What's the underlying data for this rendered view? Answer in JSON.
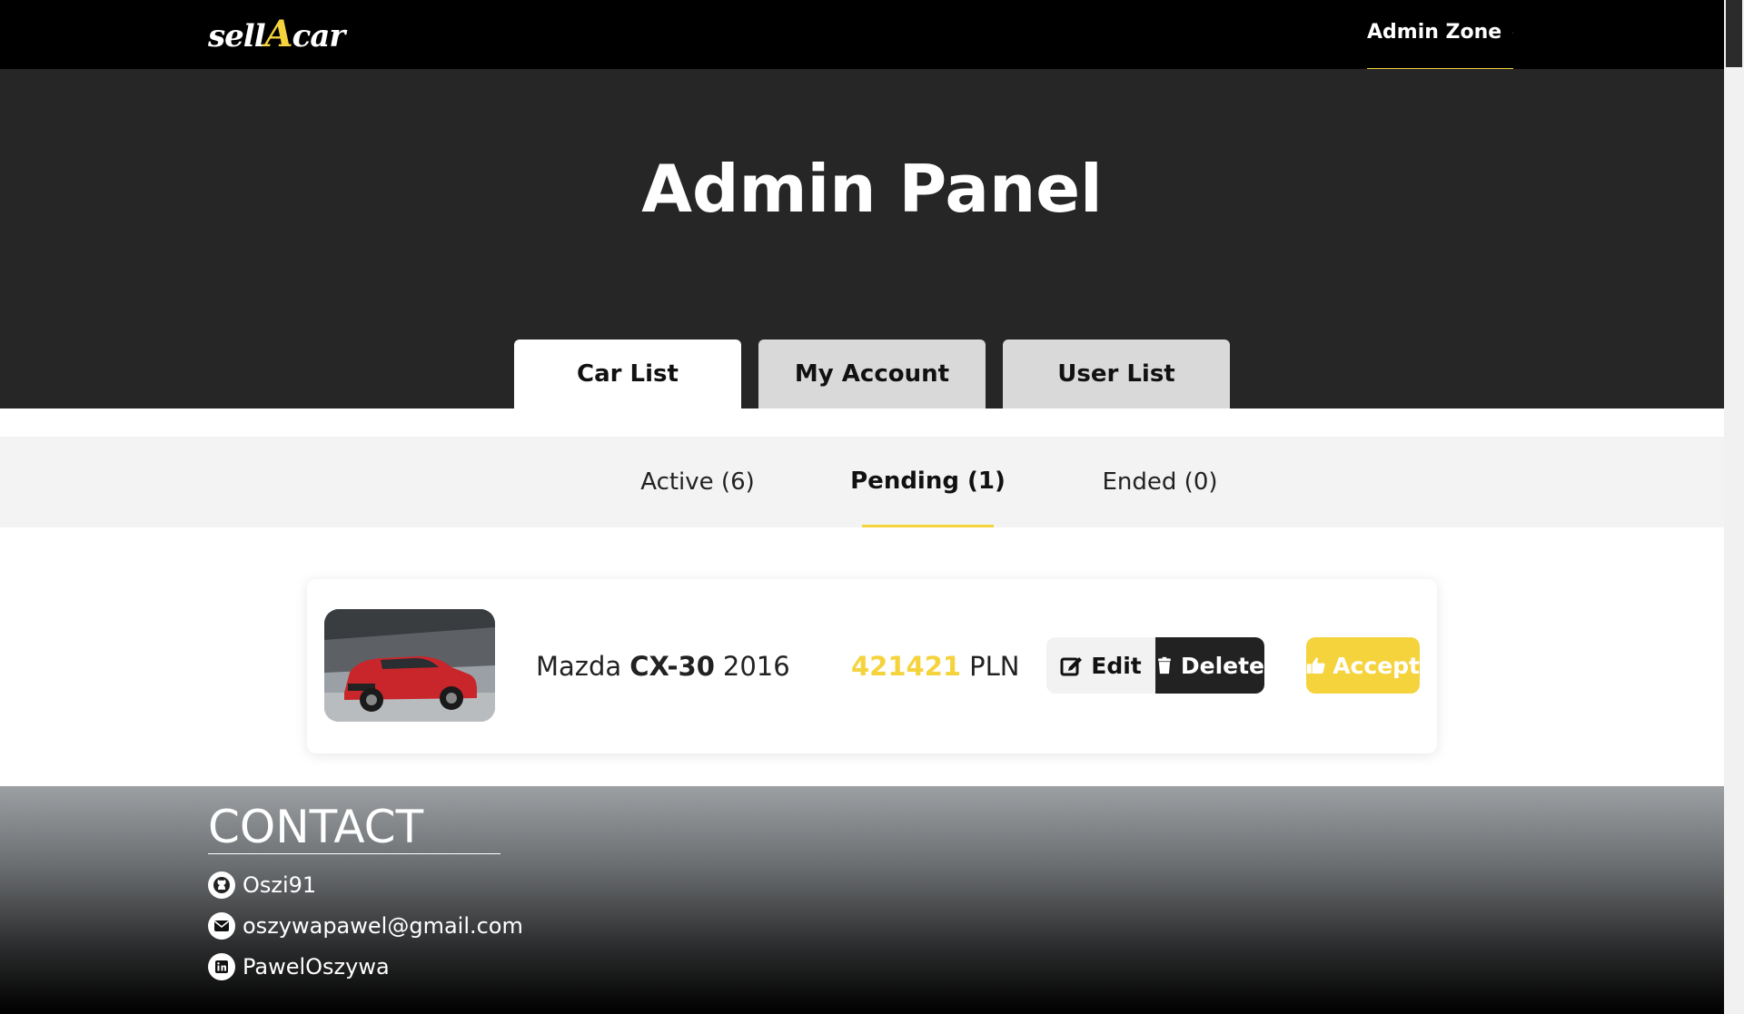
{
  "navbar": {
    "logo_prefix": "sell",
    "logo_accent": "A",
    "logo_suffix": "car",
    "admin_zone_label": "Admin Zone"
  },
  "hero": {
    "title": "Admin Panel"
  },
  "main_tabs": [
    {
      "label": "Car List",
      "active": true
    },
    {
      "label": "My Account",
      "active": false
    },
    {
      "label": "User List",
      "active": false
    }
  ],
  "sub_tabs": [
    {
      "label": "Active (6)",
      "active": false
    },
    {
      "label": "Pending (1)",
      "active": true
    },
    {
      "label": "Ended (0)",
      "active": false
    }
  ],
  "cars": [
    {
      "make": "Mazda",
      "model": "CX-30",
      "year": "2016",
      "price": "421421",
      "currency": "PLN",
      "edit_label": "Edit",
      "delete_label": "Delete",
      "accept_label": "Accept"
    }
  ],
  "footer": {
    "title": "CONTACT",
    "github": "Oszi91",
    "email": "oszywapawel@gmail.com",
    "linkedin": "PawelOszywa"
  },
  "colors": {
    "accent": "#f5d33d",
    "navbar_bg": "#000000",
    "hero_bg": "#262626",
    "tab_inactive": "#d9d9d9",
    "delete_bg": "#222222"
  },
  "icons": {
    "admin_zone": "user-icon",
    "edit": "edit-icon",
    "delete": "trash-icon",
    "accept": "thumbs-up-icon",
    "github": "github-icon",
    "email": "envelope-icon",
    "linkedin": "linkedin-icon"
  }
}
